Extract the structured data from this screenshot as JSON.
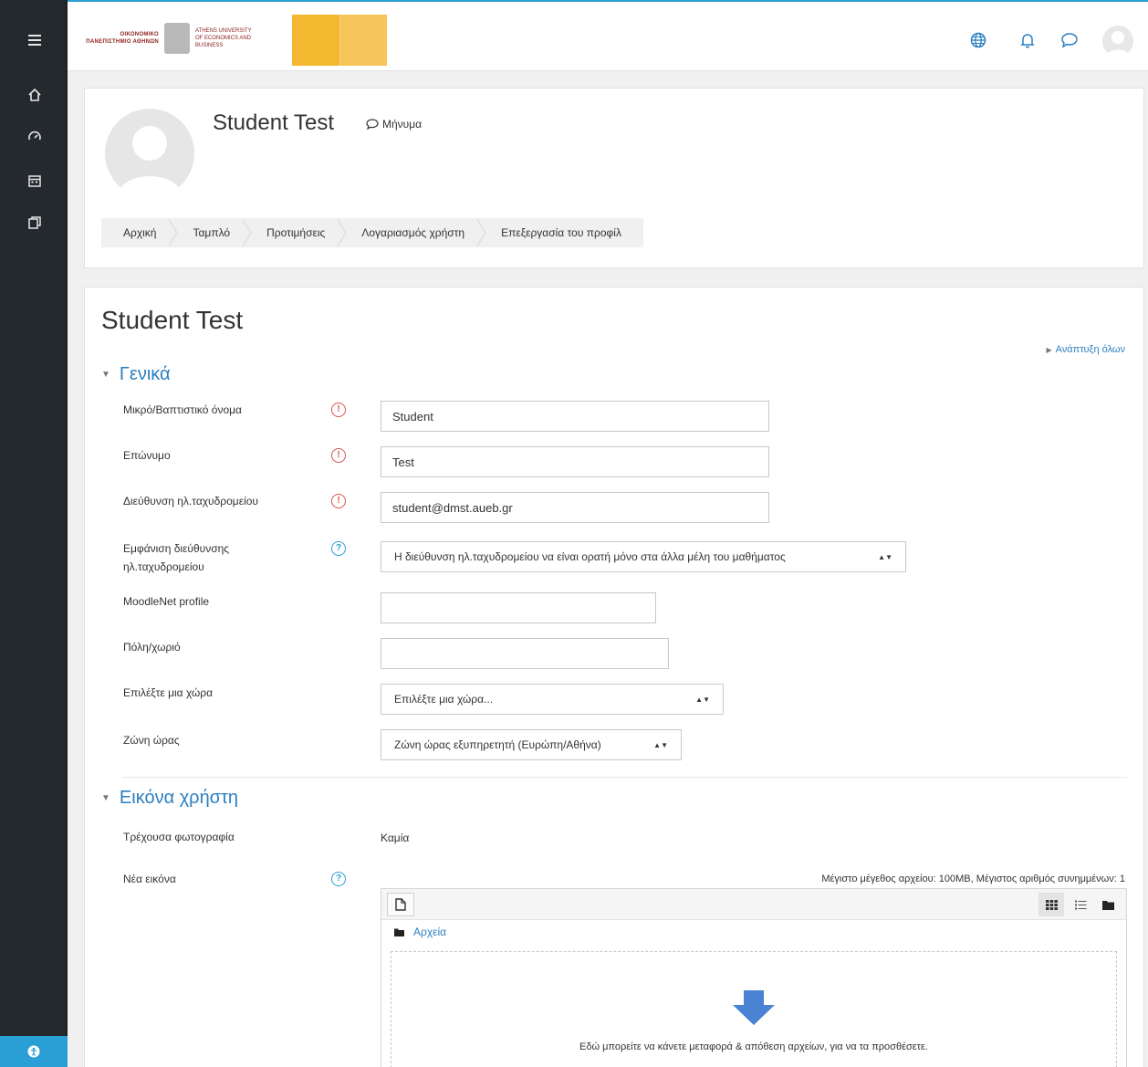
{
  "navbar": {
    "logo_aueb": {
      "greek": "ΟΙΚΟΝΟΜΙΚΟ ΠΑΝΕΠΙΣΤΗΜΙΟ ΑΘΗΝΩΝ",
      "english": "ATHENS UNIVERSITY OF ECONOMICS AND BUSINESS"
    },
    "icons": [
      "language-icon",
      "notification-icon",
      "messages-icon",
      "user-avatar"
    ]
  },
  "drawer": {
    "items": [
      "menu-toggle-icon",
      "home-icon",
      "dashboard-icon",
      "calendar-icon",
      "files-icon"
    ],
    "bottom": "accessibility-icon"
  },
  "header": {
    "name": "Student Test",
    "message_label": "Μήνυμα",
    "breadcrumb": [
      "Αρχική",
      "Ταμπλό",
      "Προτιμήσεις",
      "Λογαριασμός χρήστη",
      "Επεξεργασία του προφίλ"
    ]
  },
  "main": {
    "title": "Student Test",
    "expand_all": "Ανάπτυξη όλων",
    "general": {
      "heading": "Γενικά",
      "first_name_label": "Μικρό/Βαπτιστικό όνομα",
      "first_name_value": "Student",
      "last_name_label": "Επώνυμο",
      "last_name_value": "Test",
      "email_label": "Διεύθυνση ηλ.ταχυδρομείου",
      "email_value": "student@dmst.aueb.gr",
      "email_display_label": "Εμφάνιση διεύθυνσης ηλ.ταχυδρομείου",
      "email_display_value": "Η διεύθυνση ηλ.ταχυδρομείου να είναι ορατή μόνο στα άλλα μέλη του μαθήματος",
      "moodlenet_label": "MoodleNet profile",
      "moodlenet_value": "",
      "city_label": "Πόλη/χωριό",
      "city_value": "",
      "country_label": "Επιλέξτε μια χώρα",
      "country_value": "Επιλέξτε μια χώρα...",
      "timezone_label": "Ζώνη ώρας",
      "timezone_value": "Ζώνη ώρας εξυπηρετητή (Ευρώπη/Αθήνα)"
    },
    "picture": {
      "heading": "Εικόνα χρήστη",
      "current_label": "Τρέχουσα φωτογραφία",
      "current_value": "Καμία",
      "new_label": "Νέα εικόνα",
      "max_info": "Μέγιστο μέγεθος αρχείου: 100MB, Μέγιστος αριθμός συνημμένων: 1",
      "path_label": "Αρχεία",
      "drop_text": "Εδώ μπορείτε να κάνετε μεταφορά & απόθεση αρχείων, για να τα προσθέσετε."
    }
  },
  "colors": {
    "accent": "#2a9fd6",
    "link": "#2a7fc1",
    "required": "#d9534f",
    "drawer_bg": "#24292e",
    "drop_arrow": "#4a82d4"
  }
}
